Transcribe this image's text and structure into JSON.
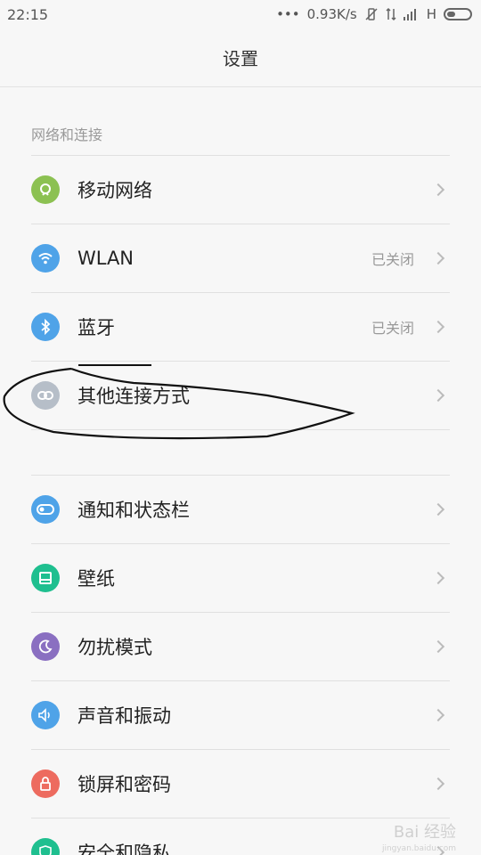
{
  "status_bar": {
    "time": "22:15",
    "dots": "•••",
    "speed": "0.93K/s",
    "network": "H"
  },
  "header": {
    "title": "设置"
  },
  "section": {
    "title": "网络和连接",
    "items": [
      {
        "label": "移动网络",
        "value": "",
        "icon": "mobile-network-icon",
        "color": "#8cc152"
      },
      {
        "label": "WLAN",
        "value": "已关闭",
        "icon": "wifi-icon",
        "color": "#4fa3e8"
      },
      {
        "label": "蓝牙",
        "value": "已关闭",
        "icon": "bluetooth-icon",
        "color": "#4fa3e8"
      },
      {
        "label": "其他连接方式",
        "value": "",
        "icon": "link-icon",
        "color": "#b6bec8"
      }
    ]
  },
  "section2": {
    "items": [
      {
        "label": "通知和状态栏",
        "value": "",
        "icon": "toggle-icon",
        "color": "#4fa3e8"
      },
      {
        "label": "壁纸",
        "value": "",
        "icon": "wallpaper-icon",
        "color": "#1fbf8f"
      },
      {
        "label": "勿扰模式",
        "value": "",
        "icon": "moon-icon",
        "color": "#8a6fc1"
      },
      {
        "label": "声音和振动",
        "value": "",
        "icon": "speaker-icon",
        "color": "#4fa3e8"
      },
      {
        "label": "锁屏和密码",
        "value": "",
        "icon": "lock-icon",
        "color": "#ed6b5f"
      },
      {
        "label": "安全和隐私",
        "value": "",
        "icon": "shield-icon",
        "color": "#1fbf8f"
      }
    ]
  },
  "watermark": {
    "text": "Bai 经验",
    "sub": "jingyan.baidu.com"
  }
}
